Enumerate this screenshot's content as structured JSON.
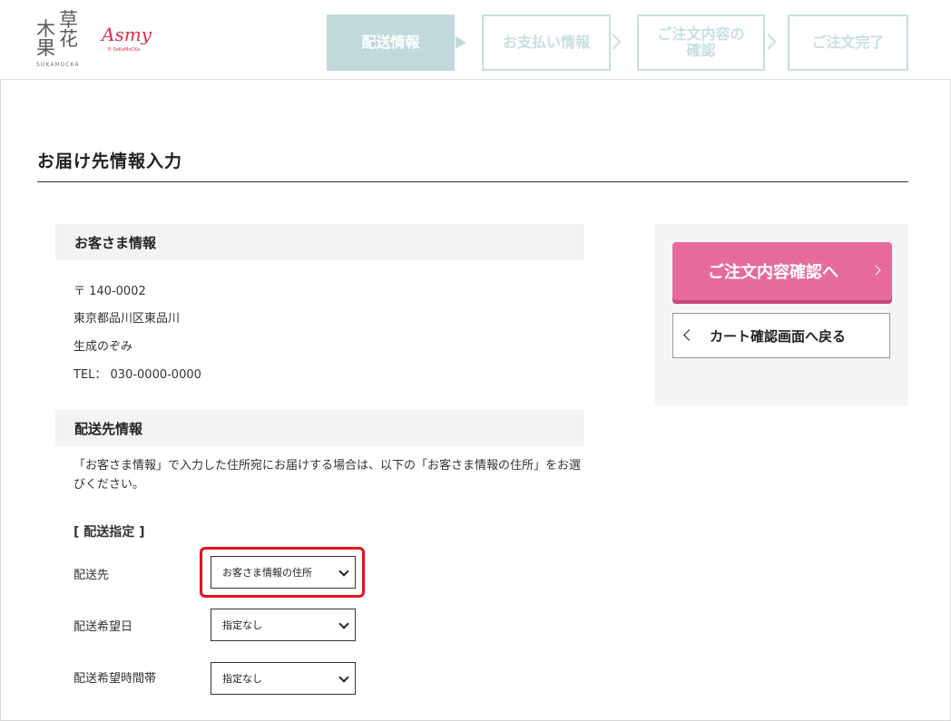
{
  "header": {
    "logo_main": {
      "k1": "草",
      "k2": "花",
      "k3": "木",
      "k4": "果",
      "sub": "SOKAMOCKA"
    },
    "logo_secondary": {
      "name": "Asmy",
      "sub": "® SoKaMoCKa"
    },
    "steps": [
      {
        "label": "配送情報",
        "state": "active"
      },
      {
        "label": "お支払い情報",
        "state": "inactive"
      },
      {
        "label": "ご注文内容の\n確認",
        "state": "inactive"
      },
      {
        "label": "ご注文完了",
        "state": "inactive"
      }
    ]
  },
  "page_title": "お届け先情報入力",
  "customer": {
    "heading": "お客さま情報",
    "postal": "〒 140-0002",
    "address": "東京都品川区東品川",
    "name": "生成のぞみ",
    "tel": "TEL： 030-0000-0000"
  },
  "delivery": {
    "heading": "配送先情報",
    "notice": "「お客さま情報」で入力した住所宛にお届けする場合は、以下の「お客さま情報の住所」をお選びください。",
    "sub_heading": "[ 配送指定 ]",
    "fields": [
      {
        "label": "配送先",
        "value": "お客さま情報の住所"
      },
      {
        "label": "配送希望日",
        "value": "指定なし"
      },
      {
        "label": "配送希望時間帯",
        "value": "指定なし"
      }
    ]
  },
  "side": {
    "confirm_label": "ご注文内容確認へ",
    "back_label": "カート確認画面へ戻る"
  },
  "colors": {
    "accent_pink": "#e76b9a",
    "step_active": "#c2d9db",
    "step_inactive": "#c7dfe0",
    "highlight_red": "#e3131e"
  }
}
